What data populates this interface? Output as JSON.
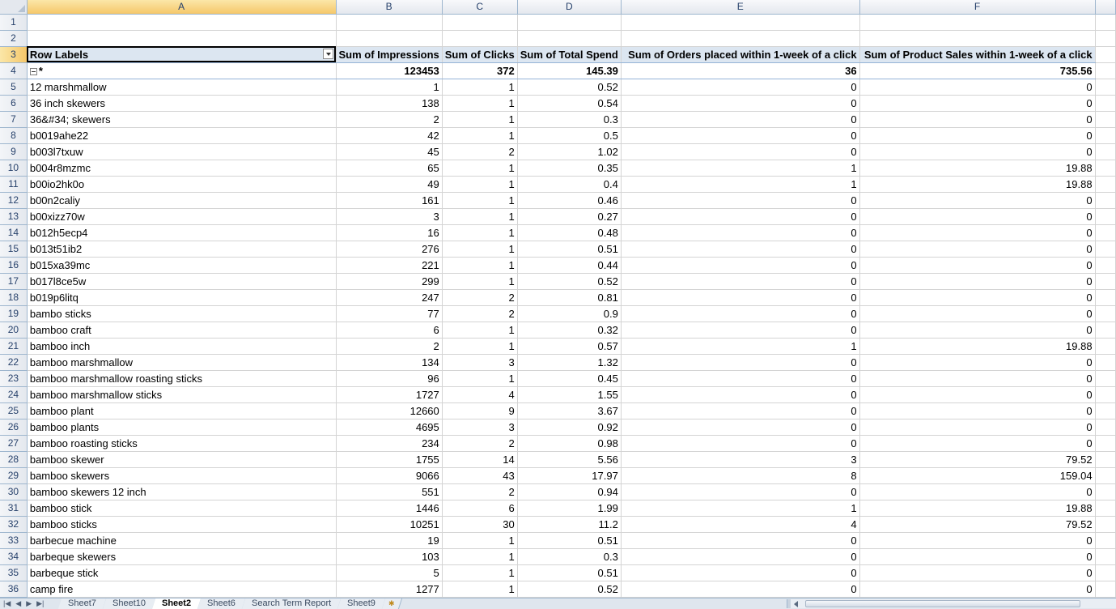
{
  "columns": [
    "A",
    "B",
    "C",
    "D",
    "E",
    "F"
  ],
  "rows_empty": [
    "1",
    "2"
  ],
  "header_row_num": "3",
  "headers": {
    "row_labels": "Row Labels",
    "impressions": "Sum of Impressions",
    "clicks": "Sum of Clicks",
    "spend": "Sum of Total Spend",
    "orders": "Sum of Orders placed within 1-week of a click",
    "sales": "Sum of Product Sales within 1-week of a click"
  },
  "total": {
    "row": "4",
    "label": "*",
    "impressions": "123453",
    "clicks": "372",
    "spend": "145.39",
    "orders": "36",
    "sales": "735.56"
  },
  "data_rows": [
    {
      "row": "5",
      "label": "12 marshmallow",
      "impressions": "1",
      "clicks": "1",
      "spend": "0.52",
      "orders": "0",
      "sales": "0"
    },
    {
      "row": "6",
      "label": "36 inch skewers",
      "impressions": "138",
      "clicks": "1",
      "spend": "0.54",
      "orders": "0",
      "sales": "0"
    },
    {
      "row": "7",
      "label": "36&#34; skewers",
      "impressions": "2",
      "clicks": "1",
      "spend": "0.3",
      "orders": "0",
      "sales": "0"
    },
    {
      "row": "8",
      "label": "b0019ahe22",
      "impressions": "42",
      "clicks": "1",
      "spend": "0.5",
      "orders": "0",
      "sales": "0"
    },
    {
      "row": "9",
      "label": "b003l7txuw",
      "impressions": "45",
      "clicks": "2",
      "spend": "1.02",
      "orders": "0",
      "sales": "0"
    },
    {
      "row": "10",
      "label": "b004r8mzmc",
      "impressions": "65",
      "clicks": "1",
      "spend": "0.35",
      "orders": "1",
      "sales": "19.88"
    },
    {
      "row": "11",
      "label": "b00io2hk0o",
      "impressions": "49",
      "clicks": "1",
      "spend": "0.4",
      "orders": "1",
      "sales": "19.88"
    },
    {
      "row": "12",
      "label": "b00n2caliy",
      "impressions": "161",
      "clicks": "1",
      "spend": "0.46",
      "orders": "0",
      "sales": "0"
    },
    {
      "row": "13",
      "label": "b00xizz70w",
      "impressions": "3",
      "clicks": "1",
      "spend": "0.27",
      "orders": "0",
      "sales": "0"
    },
    {
      "row": "14",
      "label": "b012h5ecp4",
      "impressions": "16",
      "clicks": "1",
      "spend": "0.48",
      "orders": "0",
      "sales": "0"
    },
    {
      "row": "15",
      "label": "b013t51ib2",
      "impressions": "276",
      "clicks": "1",
      "spend": "0.51",
      "orders": "0",
      "sales": "0"
    },
    {
      "row": "16",
      "label": "b015xa39mc",
      "impressions": "221",
      "clicks": "1",
      "spend": "0.44",
      "orders": "0",
      "sales": "0"
    },
    {
      "row": "17",
      "label": "b017l8ce5w",
      "impressions": "299",
      "clicks": "1",
      "spend": "0.52",
      "orders": "0",
      "sales": "0"
    },
    {
      "row": "18",
      "label": "b019p6litq",
      "impressions": "247",
      "clicks": "2",
      "spend": "0.81",
      "orders": "0",
      "sales": "0"
    },
    {
      "row": "19",
      "label": "bambo sticks",
      "impressions": "77",
      "clicks": "2",
      "spend": "0.9",
      "orders": "0",
      "sales": "0"
    },
    {
      "row": "20",
      "label": "bamboo craft",
      "impressions": "6",
      "clicks": "1",
      "spend": "0.32",
      "orders": "0",
      "sales": "0"
    },
    {
      "row": "21",
      "label": "bamboo inch",
      "impressions": "2",
      "clicks": "1",
      "spend": "0.57",
      "orders": "1",
      "sales": "19.88"
    },
    {
      "row": "22",
      "label": "bamboo marshmallow",
      "impressions": "134",
      "clicks": "3",
      "spend": "1.32",
      "orders": "0",
      "sales": "0"
    },
    {
      "row": "23",
      "label": "bamboo marshmallow roasting sticks",
      "impressions": "96",
      "clicks": "1",
      "spend": "0.45",
      "orders": "0",
      "sales": "0"
    },
    {
      "row": "24",
      "label": "bamboo marshmallow sticks",
      "impressions": "1727",
      "clicks": "4",
      "spend": "1.55",
      "orders": "0",
      "sales": "0"
    },
    {
      "row": "25",
      "label": "bamboo plant",
      "impressions": "12660",
      "clicks": "9",
      "spend": "3.67",
      "orders": "0",
      "sales": "0"
    },
    {
      "row": "26",
      "label": "bamboo plants",
      "impressions": "4695",
      "clicks": "3",
      "spend": "0.92",
      "orders": "0",
      "sales": "0"
    },
    {
      "row": "27",
      "label": "bamboo roasting sticks",
      "impressions": "234",
      "clicks": "2",
      "spend": "0.98",
      "orders": "0",
      "sales": "0"
    },
    {
      "row": "28",
      "label": "bamboo skewer",
      "impressions": "1755",
      "clicks": "14",
      "spend": "5.56",
      "orders": "3",
      "sales": "79.52"
    },
    {
      "row": "29",
      "label": "bamboo skewers",
      "impressions": "9066",
      "clicks": "43",
      "spend": "17.97",
      "orders": "8",
      "sales": "159.04"
    },
    {
      "row": "30",
      "label": "bamboo skewers 12 inch",
      "impressions": "551",
      "clicks": "2",
      "spend": "0.94",
      "orders": "0",
      "sales": "0"
    },
    {
      "row": "31",
      "label": "bamboo stick",
      "impressions": "1446",
      "clicks": "6",
      "spend": "1.99",
      "orders": "1",
      "sales": "19.88"
    },
    {
      "row": "32",
      "label": "bamboo sticks",
      "impressions": "10251",
      "clicks": "30",
      "spend": "11.2",
      "orders": "4",
      "sales": "79.52"
    },
    {
      "row": "33",
      "label": "barbecue machine",
      "impressions": "19",
      "clicks": "1",
      "spend": "0.51",
      "orders": "0",
      "sales": "0"
    },
    {
      "row": "34",
      "label": "barbeque skewers",
      "impressions": "103",
      "clicks": "1",
      "spend": "0.3",
      "orders": "0",
      "sales": "0"
    },
    {
      "row": "35",
      "label": "barbeque stick",
      "impressions": "5",
      "clicks": "1",
      "spend": "0.51",
      "orders": "0",
      "sales": "0"
    },
    {
      "row": "36",
      "label": "camp fire",
      "impressions": "1277",
      "clicks": "1",
      "spend": "0.52",
      "orders": "0",
      "sales": "0"
    }
  ],
  "tabs": [
    {
      "label": "Sheet7",
      "active": false
    },
    {
      "label": "Sheet10",
      "active": false
    },
    {
      "label": "Sheet2",
      "active": true
    },
    {
      "label": "Sheet6",
      "active": false
    },
    {
      "label": "Search Term Report",
      "active": false
    },
    {
      "label": "Sheet9",
      "active": false
    }
  ],
  "nav_buttons": [
    "|◀",
    "◀",
    "▶",
    "▶|"
  ],
  "colors": {
    "header_fill": "#dce6f1",
    "selected_header": "#f5c76a",
    "grid_line": "#d4d4d4"
  }
}
